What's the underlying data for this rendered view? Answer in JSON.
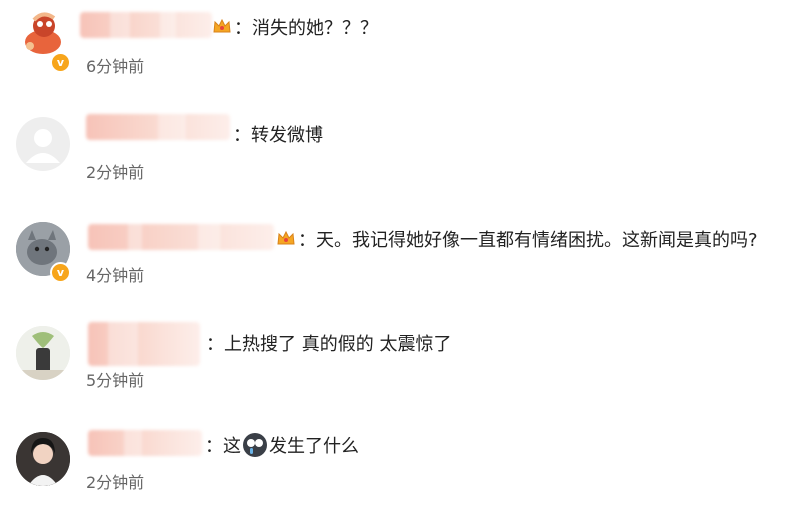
{
  "comments": [
    {
      "text": "消失的她？？？",
      "time": "6分钟前",
      "verified": true,
      "crown": true
    },
    {
      "text": "转发微博",
      "time": "2分钟前",
      "verified": false,
      "crown": false
    },
    {
      "text": "天。我记得她好像一直都有情绪困扰。这新闻是真的吗?",
      "time": "4分钟前",
      "verified": true,
      "crown": true
    },
    {
      "text": "上热搜了 真的假的 太震惊了",
      "time": "5分钟前",
      "verified": false,
      "crown": false
    },
    {
      "text_before_emoji": "这",
      "emoji": "doge-tear-icon",
      "text_after_emoji": "发生了什么",
      "time": "2分钟前",
      "verified": false,
      "crown": false
    }
  ],
  "separator": "：",
  "verified_badge_label": "v",
  "colors": {
    "verified": "#f7a51b",
    "blur_name": "#f7c3b8",
    "time": "#666666",
    "text": "#222222"
  }
}
